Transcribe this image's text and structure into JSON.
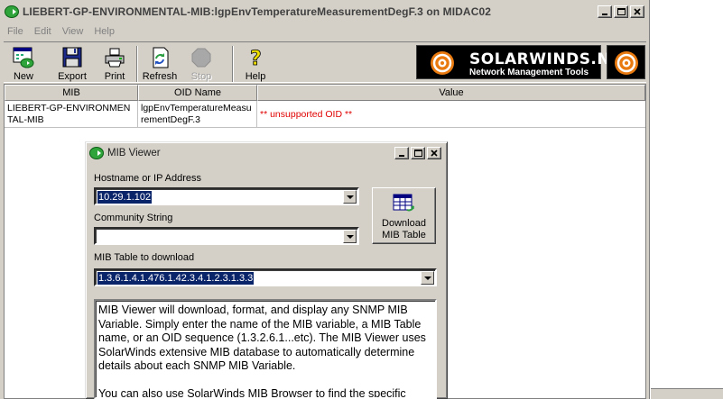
{
  "window": {
    "title": "LIEBERT-GP-ENVIRONMENTAL-MIB:lgpEnvTemperatureMeasurementDegF.3 on MIDAC02"
  },
  "menu": [
    "File",
    "Edit",
    "View",
    "Help"
  ],
  "toolbar": {
    "new_label": "New",
    "export_label": "Export",
    "print_label": "Print",
    "refresh_label": "Refresh",
    "stop_label": "Stop",
    "help_label": "Help"
  },
  "banner": {
    "brand": "SOLARWINDS.NET",
    "tagline": "Network Management Tools"
  },
  "grid": {
    "columns": [
      "MIB",
      "OID Name",
      "Value"
    ],
    "rows": [
      {
        "mib": "LIEBERT-GP-ENVIRONMENTAL-MIB",
        "oid_name": "lgpEnvTemperatureMeasurementDegF.3",
        "value": "** unsupported OID **"
      }
    ]
  },
  "dialog": {
    "title": "MIB Viewer",
    "hostname_label": "Hostname or IP Address",
    "hostname_value": "10.29.1.102",
    "community_label": "Community String",
    "community_value": "",
    "table_label": "MIB Table to download",
    "table_value": "1.3.6.1.4.1.476.1.42.3.4.1.2.3.1.3.3",
    "download_label": "Download MIB Table",
    "description_p1": "MIB Viewer will download, format, and display any SNMP MIB Variable. Simply enter the name of the MIB variable, a MIB Table name, or an OID sequence (1.3.2.6.1...etc). The MIB Viewer uses SolarWinds extensive MIB database to automatically determine details about each SNMP MIB Variable.",
    "description_p2": "You can also use SolarWinds MIB Browser to find the specific"
  },
  "colors": {
    "chrome": "#d4d0c8",
    "selection": "#0a246a",
    "error_text": "#e00000",
    "banner_bg": "#000000"
  },
  "icons": {
    "app": "green-arrow-icon",
    "new": "new-window-icon",
    "export": "floppy-disk-icon",
    "print": "printer-icon",
    "refresh": "refresh-icon",
    "stop": "stop-octagon-icon",
    "help": "question-mark-icon",
    "download": "table-download-icon",
    "brand": "sun-swirl-icon"
  }
}
